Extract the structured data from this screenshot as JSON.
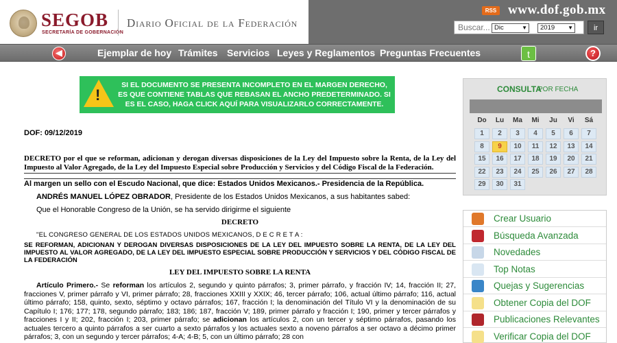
{
  "header": {
    "logo_text": "SEGOB",
    "logo_sub": "SECRETARÍA DE GOBERNACIÓN",
    "site_title": "Diario Oficial de la Federación",
    "rss_label": "RSS",
    "domain": "www.dof.gob.mx",
    "search_placeholder": "Buscar...",
    "search_button": "ir"
  },
  "nav": {
    "items": [
      "Ejemplar de hoy",
      "Trámites",
      "Servicios",
      "Leyes y Reglamentos",
      "Preguntas Frecuentes"
    ],
    "twitter_glyph": "t",
    "help_glyph": "?"
  },
  "notice": {
    "text": "SI EL DOCUMENTO SE PRESENTA INCOMPLETO EN EL MARGEN DERECHO, ES QUE CONTIENE TABLAS QUE REBASAN EL ANCHO PREDETERMINADO. SI ES EL CASO, HAGA CLICK AQUÍ PARA VISUALIZARLO CORRECTAMENTE."
  },
  "document": {
    "dof_date": "DOF: 09/12/2019",
    "title": "DECRETO por el que se reforman, adicionan y derogan diversas disposiciones de la Ley del Impuesto sobre la Renta, de la Ley del Impuesto al Valor Agregado, de la Ley del Impuesto Especial sobre Producción y Servicios y del Código Fiscal de la Federación.",
    "margin_line": "Al margen un sello con el Escudo Nacional, que dice: Estados Unidos Mexicanos.- Presidencia de la República.",
    "president_name": "ANDRÉS MANUEL LÓPEZ OBRADOR",
    "president_rest": ", Presidente de los Estados Unidos Mexicanos, a sus habitantes sabed:",
    "congress_line": "Que el Honorable Congreso de la Unión, se ha servido dirigirme el siguiente",
    "decreto_heading": "DECRETO",
    "congress_decreta": "\"EL CONGRESO GENERAL DE LOS ESTADOS UNIDOS MEXICANOS, D E C R E T A :",
    "reform_heading": "SE REFORMAN, ADICIONAN Y DEROGAN DIVERSAS DISPOSICIONES DE LA LEY DEL IMPUESTO SOBRE LA RENTA, DE LA LEY DEL IMPUESTO AL VALOR AGREGADO, DE LA LEY DEL IMPUESTO ESPECIAL SOBRE PRODUCCIÓN Y SERVICIOS Y DEL CÓDIGO FISCAL DE LA FEDERACIÓN",
    "law_heading": "LEY DEL IMPUESTO SOBRE LA RENTA",
    "article_label": "Artículo Primero.-",
    "article_se": " Se ",
    "article_reforman": "reforman",
    "article_text_1": " los artículos 2, segundo y quinto párrafos; 3, primer párrafo, y fracción IV; 14, fracción II; 27, fracciones V, primer párrafo y VI, primer párrafo; 28, fracciones XXIII y XXIX; 46, tercer párrafo; 106, actual último párrafo; 116, actual último párrafo; 158, quinto, sexto, séptimo y octavo párrafos; 167, fracción I; la denominación del Título VI y la denominación de su Capítulo I; 176; 177; 178, segundo párrafo; 183; 186; 187, fracción V; 189, primer párrafo y fracción I; 190, primer y tercer párrafos y fracciones I y II; 202, fracción I; 203, primer párrafo; se ",
    "article_adicionan": "adicionan",
    "article_text_2": " los artículos 2, con un tercer y séptimo párrafos, pasando los actuales tercero a quinto párrafos a ser cuarto a sexto párrafos y los actuales sexto a noveno párrafos a ser octavo a décimo primer párrafos; 3, con un segundo y tercer párrafos; 4-A; 4-B; 5, con un último párrafo; 28 con"
  },
  "calendar": {
    "title": "CONSULTA",
    "subtitle": "POR FECHA",
    "month": "Dic",
    "year": "2019",
    "weekdays": [
      "Do",
      "Lu",
      "Ma",
      "Mi",
      "Ju",
      "Vi",
      "Sá"
    ],
    "weeks": [
      [
        "1",
        "2",
        "3",
        "4",
        "5",
        "6",
        "7"
      ],
      [
        "8",
        "9",
        "10",
        "11",
        "12",
        "13",
        "14"
      ],
      [
        "15",
        "16",
        "17",
        "18",
        "19",
        "20",
        "21"
      ],
      [
        "22",
        "23",
        "24",
        "25",
        "26",
        "27",
        "28"
      ],
      [
        "29",
        "30",
        "31"
      ]
    ],
    "highlighted_day": "9"
  },
  "menu": {
    "items": [
      {
        "label": "Crear Usuario",
        "icon": "user-icon",
        "color": "#e0782a"
      },
      {
        "label": "Búsqueda Avanzada",
        "icon": "search-icon",
        "color": "#c0282f"
      },
      {
        "label": "Novedades",
        "icon": "news-icon",
        "color": "#c7d7e8"
      },
      {
        "label": "Top Notas",
        "icon": "star-icon",
        "color": "#d9e6f2"
      },
      {
        "label": "Quejas y Sugerencias",
        "icon": "complaint-icon",
        "color": "#3a86c8"
      },
      {
        "label": "Obtener Copia del DOF",
        "icon": "document-icon",
        "color": "#f5e08a"
      },
      {
        "label": "Publicaciones Relevantes",
        "icon": "publications-icon",
        "color": "#b0262c"
      },
      {
        "label": "Verificar Copia del DOF",
        "icon": "verify-icon",
        "color": "#f5e08a"
      }
    ]
  },
  "colors": {
    "brand": "#8a1a2b",
    "accent_green": "#2d8b3a",
    "notice_bg": "#2ec05a",
    "nav_bg": "#7a7a7a"
  }
}
